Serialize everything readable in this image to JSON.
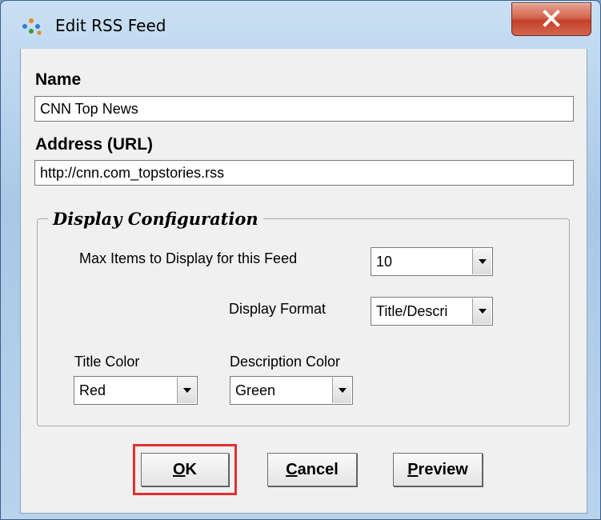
{
  "window": {
    "title": "Edit RSS Feed",
    "title_icon": "rss-feed-icon",
    "close_icon": "close-icon",
    "close_color": "#c9452f"
  },
  "form": {
    "name_label": "Name",
    "name_value": "CNN Top News",
    "address_label": "Address (URL)",
    "address_value": "http://cnn.com_topstories.rss"
  },
  "display_config": {
    "group_title": "Display Configuration",
    "max_items_label": "Max Items to Display for this Feed",
    "max_items_value": "10",
    "display_format_label": "Display Format",
    "display_format_value": "Title/Descri",
    "title_color_label": "Title Color",
    "title_color_value": "Red",
    "description_color_label": "Description Color",
    "description_color_value": "Green"
  },
  "buttons": {
    "ok": {
      "accel": "O",
      "rest": "K"
    },
    "cancel": {
      "accel": "C",
      "rest": "ancel"
    },
    "preview": {
      "accel": "P",
      "rest": "review"
    },
    "highlight_color": "#e03030"
  }
}
